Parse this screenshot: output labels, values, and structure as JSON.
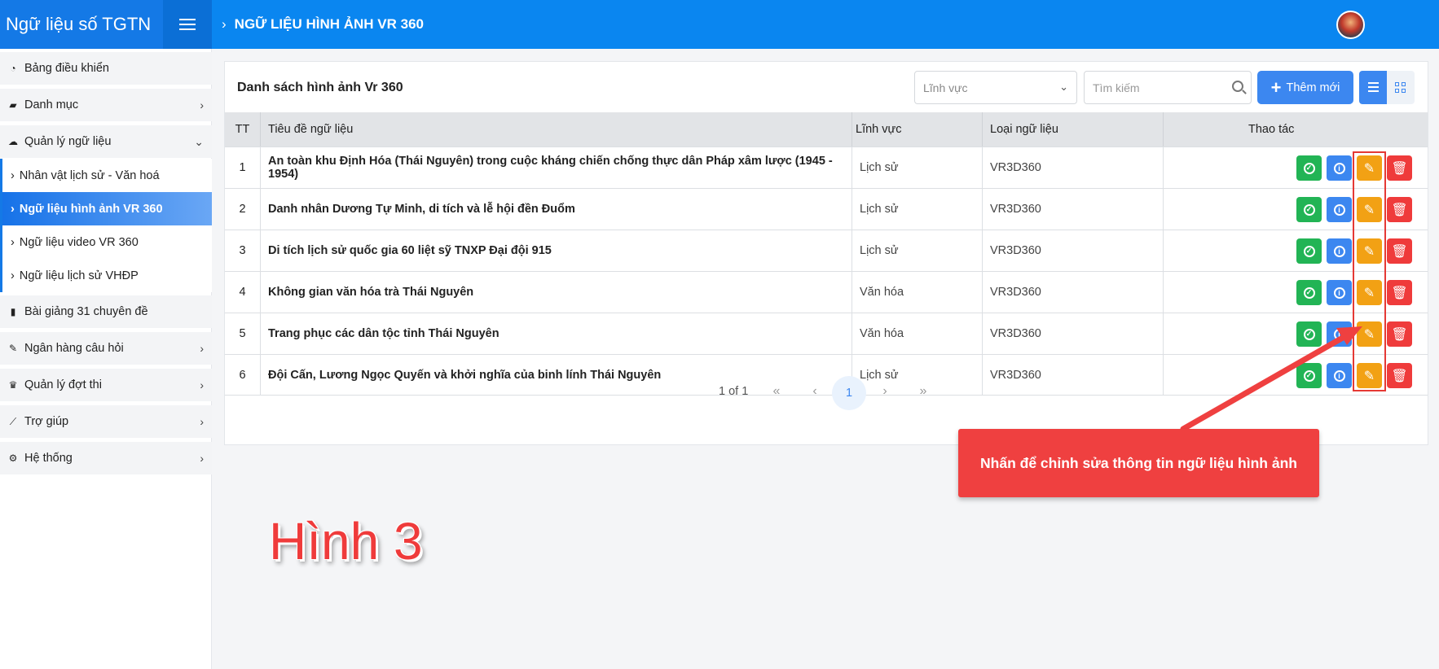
{
  "app": {
    "title": "Ngữ liệu số TGTN"
  },
  "header": {
    "breadcrumb": "NGỮ LIỆU HÌNH ẢNH VR 360"
  },
  "sidebar": {
    "items": [
      {
        "label": "Bảng điều khiển",
        "icon": "dashboard-icon"
      },
      {
        "label": "Danh mục",
        "icon": "folder-icon"
      },
      {
        "label": "Quản lý ngữ liệu",
        "icon": "cloud-icon"
      },
      {
        "label": "Bài giảng 31 chuyên đề",
        "icon": "book-icon"
      },
      {
        "label": "Ngân hàng câu hỏi",
        "icon": "edit-icon"
      },
      {
        "label": "Quản lý đợt thi",
        "icon": "trophy-icon"
      },
      {
        "label": "Trợ giúp",
        "icon": "chart-icon"
      },
      {
        "label": "Hệ thống",
        "icon": "cogs-icon"
      }
    ],
    "subitems": [
      {
        "label": "Nhân vật lịch sử - Văn hoá"
      },
      {
        "label": "Ngữ liệu hình ảnh VR 360"
      },
      {
        "label": "Ngữ liệu video VR 360"
      },
      {
        "label": "Ngữ liệu lịch sử VHĐP"
      }
    ]
  },
  "card": {
    "title": "Danh sách hình ảnh Vr 360",
    "filter_placeholder": "Lĩnh vực",
    "search_placeholder": "Tìm kiếm",
    "add_label": "Thêm mới"
  },
  "table": {
    "headers": {
      "tt": "TT",
      "title": "Tiêu đề ngữ liệu",
      "field": "Lĩnh vực",
      "type": "Loại ngữ liệu",
      "actions": "Thao tác"
    },
    "rows": [
      {
        "tt": "1",
        "title": "An toàn khu Định Hóa (Thái Nguyên) trong cuộc kháng chiến chống thực dân Pháp xâm lược (1945 - 1954)",
        "field": "Lịch sử",
        "type": "VR3D360"
      },
      {
        "tt": "2",
        "title": "Danh nhân Dương Tự Minh, di tích và lễ hội đền Đuổm",
        "field": "Lịch sử",
        "type": "VR3D360"
      },
      {
        "tt": "3",
        "title": "Di tích lịch sử quốc gia 60 liệt sỹ TNXP Đại đội 915",
        "field": "Lịch sử",
        "type": "VR3D360"
      },
      {
        "tt": "4",
        "title": "Không gian văn hóa trà Thái Nguyên",
        "field": "Văn hóa",
        "type": "VR3D360"
      },
      {
        "tt": "5",
        "title": "Trang phục các dân tộc tỉnh Thái Nguyên",
        "field": "Văn hóa",
        "type": "VR3D360"
      },
      {
        "tt": "6",
        "title": "Đội Cấn, Lương Ngọc Quyến và khởi nghĩa của binh lính Thái Nguyên",
        "field": "Lịch sử",
        "type": "VR3D360"
      }
    ]
  },
  "pagination": {
    "info": "1 of 1",
    "current": "1"
  },
  "annotation": {
    "callout": "Nhấn để chỉnh sửa thông tin ngữ liệu hình ảnh",
    "figure_label": "Hình 3",
    "color": "#ef4040"
  }
}
